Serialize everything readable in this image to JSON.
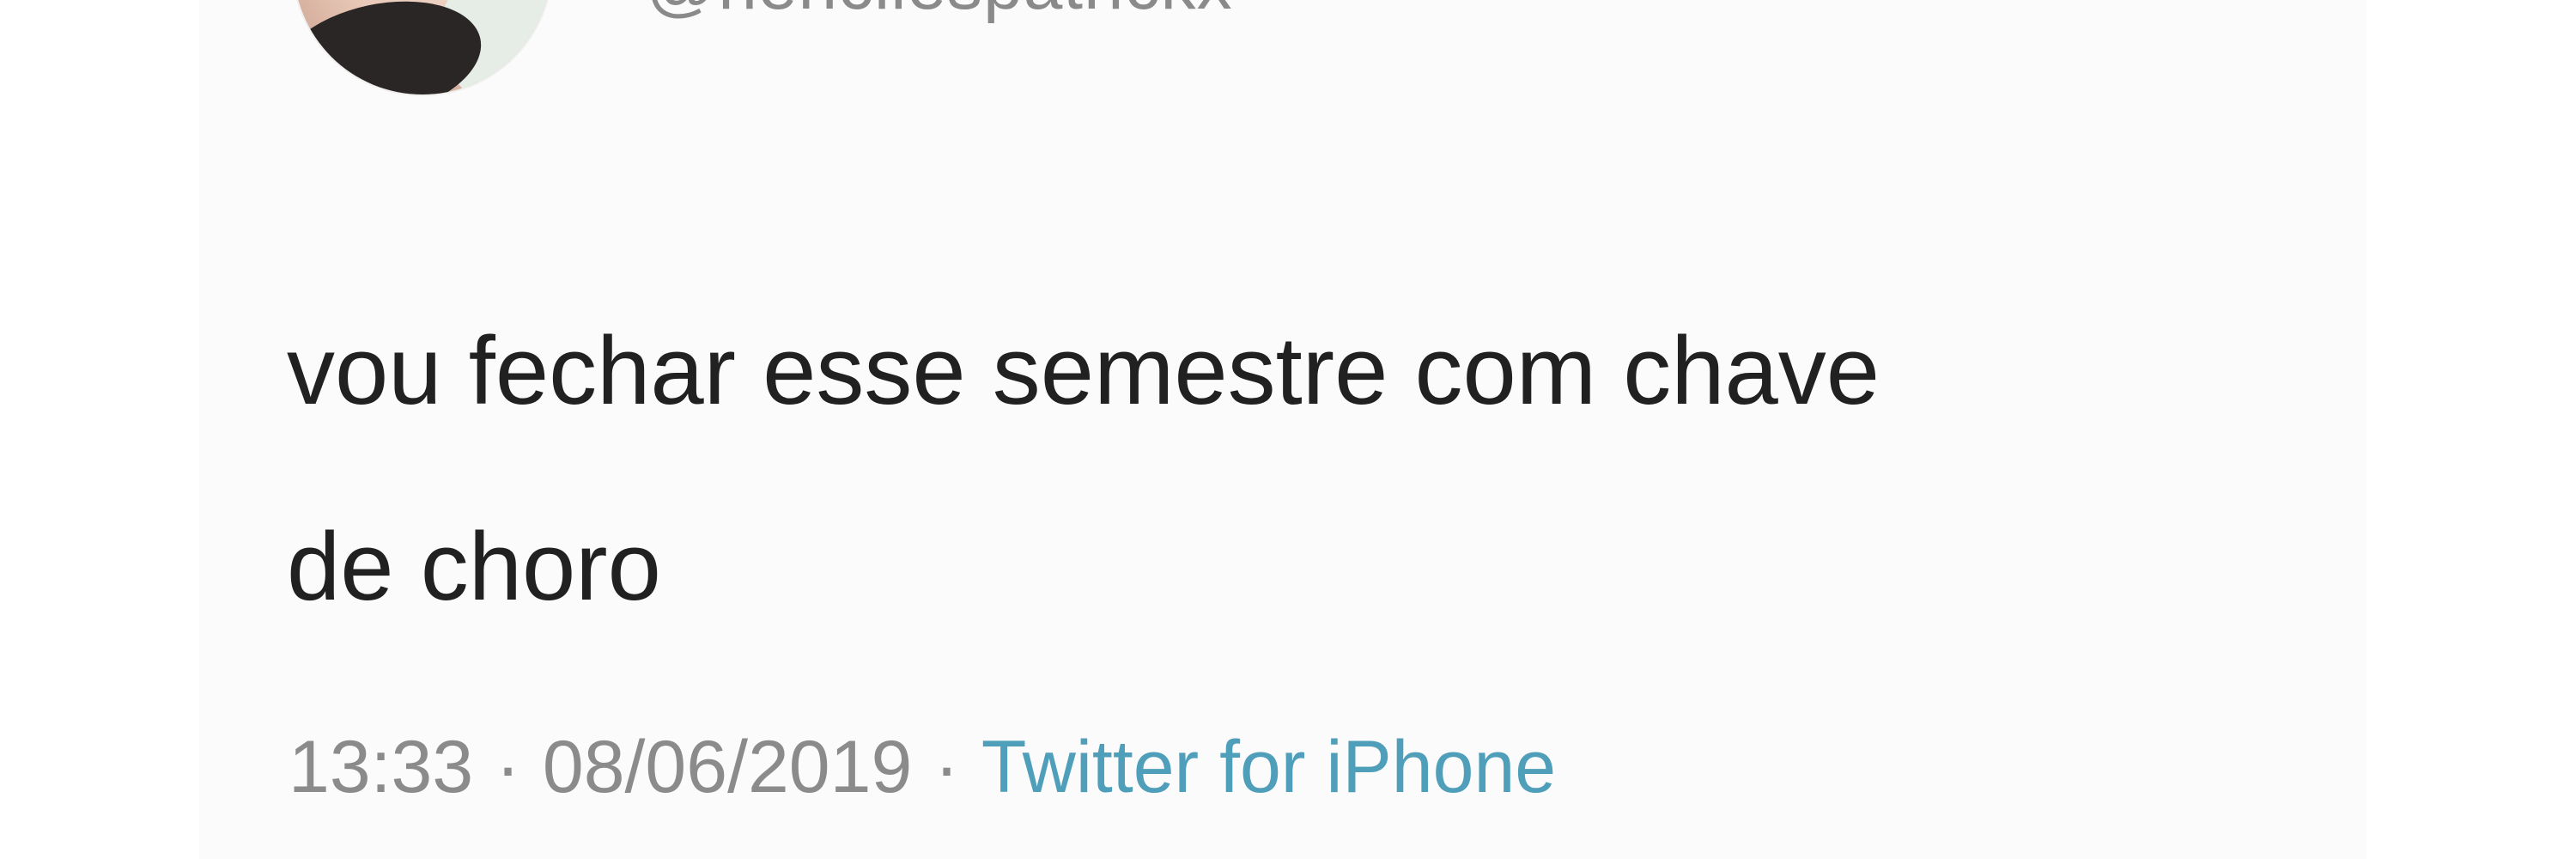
{
  "tweet": {
    "handle": "@hencilespatrickx",
    "text": "vou fechar esse semestre com chave\nde choro",
    "time": "13:33",
    "date": "08/06/2019",
    "separator": "·",
    "source": "Twitter for iPhone"
  },
  "colors": {
    "source_link": "#4f9fba",
    "meta_text": "#8b8b8b",
    "body_text": "#212121"
  }
}
